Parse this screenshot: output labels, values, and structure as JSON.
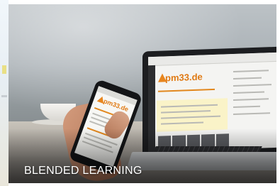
{
  "card": {
    "caption": "BLENDED LEARNING"
  },
  "laptop_screen": {
    "logo_text": "pm33.de"
  },
  "phone_screen": {
    "logo_text": "pm33.de"
  },
  "colors": {
    "brand_orange": "#e07a14",
    "caption_text": "#ffffff"
  }
}
